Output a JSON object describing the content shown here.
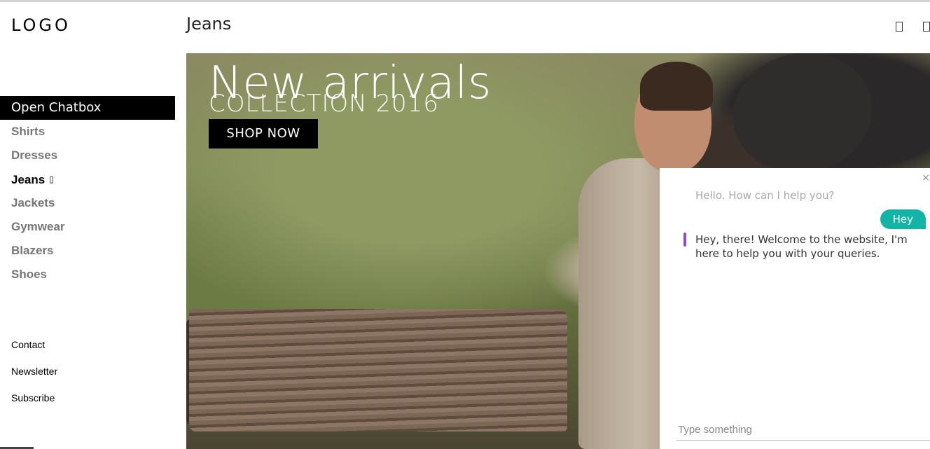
{
  "sidebar": {
    "logo": "LOGO",
    "chat_button": "Open Chatbox",
    "nav": [
      {
        "label": "Shirts"
      },
      {
        "label": "Dresses"
      },
      {
        "label": "Jeans",
        "active": true,
        "caret": "▯"
      },
      {
        "label": "Jackets"
      },
      {
        "label": "Gymwear"
      },
      {
        "label": "Blazers"
      },
      {
        "label": "Shoes"
      }
    ],
    "footer_links": [
      "Contact",
      "Newsletter",
      "Subscribe"
    ]
  },
  "header": {
    "title": "Jeans",
    "icons": [
      "square-icon",
      "square-icon"
    ]
  },
  "hero": {
    "title": "New arrivals",
    "subtitle": "COLLECTION 2016",
    "cta": "SHOP NOW"
  },
  "chat": {
    "close_glyph": "×",
    "messages": [
      {
        "from": "bot",
        "text": "Hello. How can I help you?"
      },
      {
        "from": "user",
        "text": "Hey"
      },
      {
        "from": "bot",
        "text": "Hey, there! Welcome to the website, I'm here to help you with your queries."
      }
    ],
    "input_placeholder": "Type something",
    "colors": {
      "user_bubble": "#12b5a5",
      "bot_marker": "#8b4bd3"
    }
  }
}
